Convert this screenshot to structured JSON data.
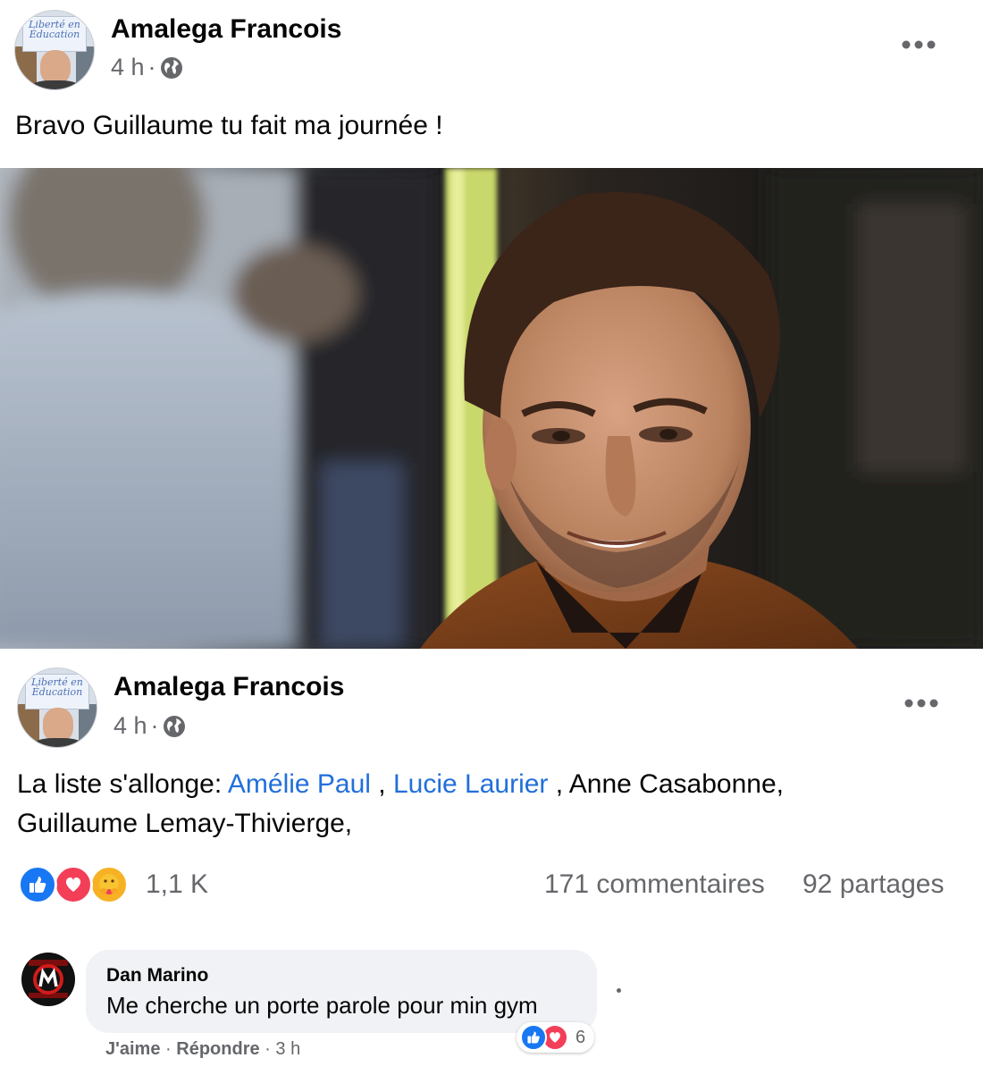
{
  "post1": {
    "author": "Amalega Francois",
    "time": "4 h",
    "separator": "·",
    "avatar_sign": "Liberté en Éducation",
    "text": "Bravo Guillaume tu fait ma journée !"
  },
  "post2": {
    "author": "Amalega Francois",
    "time": "4 h",
    "separator": "·",
    "avatar_sign": "Liberté en Éducation",
    "text_intro": "La liste s'allonge: ",
    "mention1": "Amélie Paul",
    "sep1": " , ",
    "mention2": "Lucie Laurier",
    "text_rest": " , Anne Casabonne,",
    "text_line2": "Guillaume Lemay-Thivierge,",
    "reactions_count": "1,1 K",
    "comments_count": "171 commentaires",
    "shares_count": "92 partages"
  },
  "comment": {
    "author": "Dan Marino",
    "text": "Me cherche un porte parole pour min gym",
    "like": "J'aime",
    "reply": "Répondre",
    "dot": "·",
    "time": "3 h",
    "reaction_count": "6",
    "avatar_text": "FITNESS GYM"
  },
  "icons": {
    "globe": "globe-icon",
    "more": "more-options-icon",
    "like": "like-reaction-icon",
    "love": "love-reaction-icon",
    "care": "care-reaction-icon"
  },
  "colors": {
    "like_blue": "#1877f2",
    "love_red": "#f33e58",
    "care_yellow": "#f7b125",
    "link_blue": "#216fdb",
    "secondary_text": "#65676b",
    "bubble_bg": "#f0f2f5"
  }
}
